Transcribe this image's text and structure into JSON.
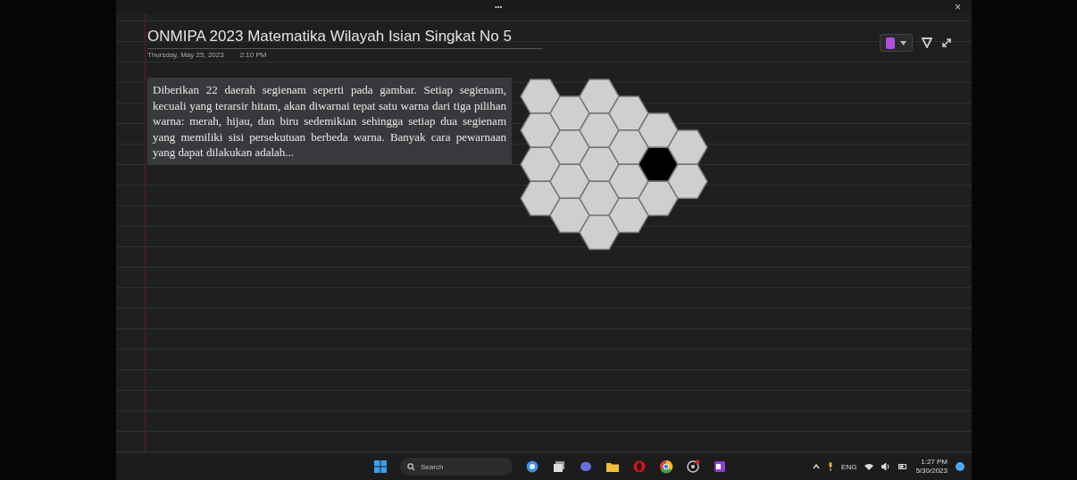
{
  "window": {
    "menu": "•••",
    "close": "×"
  },
  "page": {
    "title": "ONMIPA 2023 Matematika Wilayah Isian Singkat No 5",
    "date": "Thursday, May 25, 2023",
    "time": "2:10 PM"
  },
  "problem": {
    "text": "Diberikan 22 daerah segienam seperti pada gambar.  Setiap segienam, kecuali yang terarsir hitam, akan diwarnai tepat satu warna dari tiga pilihan warna: merah, hijau, dan biru sedemikian sehingga setiap dua segienam yang memiliki sisi persekutuan berbeda warna. Banyak cara pewarnaan yang dapat dilakukan adalah..."
  },
  "figure": {
    "hexagons": [
      {
        "shaded": false
      },
      {
        "shaded": false
      },
      {
        "shaded": false
      },
      {
        "shaded": false
      },
      {
        "shaded": false
      },
      {
        "shaded": false
      },
      {
        "shaded": false
      },
      {
        "shaded": false
      },
      {
        "shaded": false
      },
      {
        "shaded": false
      },
      {
        "shaded": false
      },
      {
        "shaded": false
      },
      {
        "shaded": false
      },
      {
        "shaded": false
      },
      {
        "shaded": false
      },
      {
        "shaded": false
      },
      {
        "shaded": false
      },
      {
        "shaded": false
      },
      {
        "shaded": true
      },
      {
        "shaded": false
      },
      {
        "shaded": false
      },
      {
        "shaded": false
      }
    ]
  },
  "taskbar": {
    "search_placeholder": "Search",
    "language": "ENG",
    "clock_time": "1:27 PM",
    "clock_date": "5/30/2023"
  }
}
